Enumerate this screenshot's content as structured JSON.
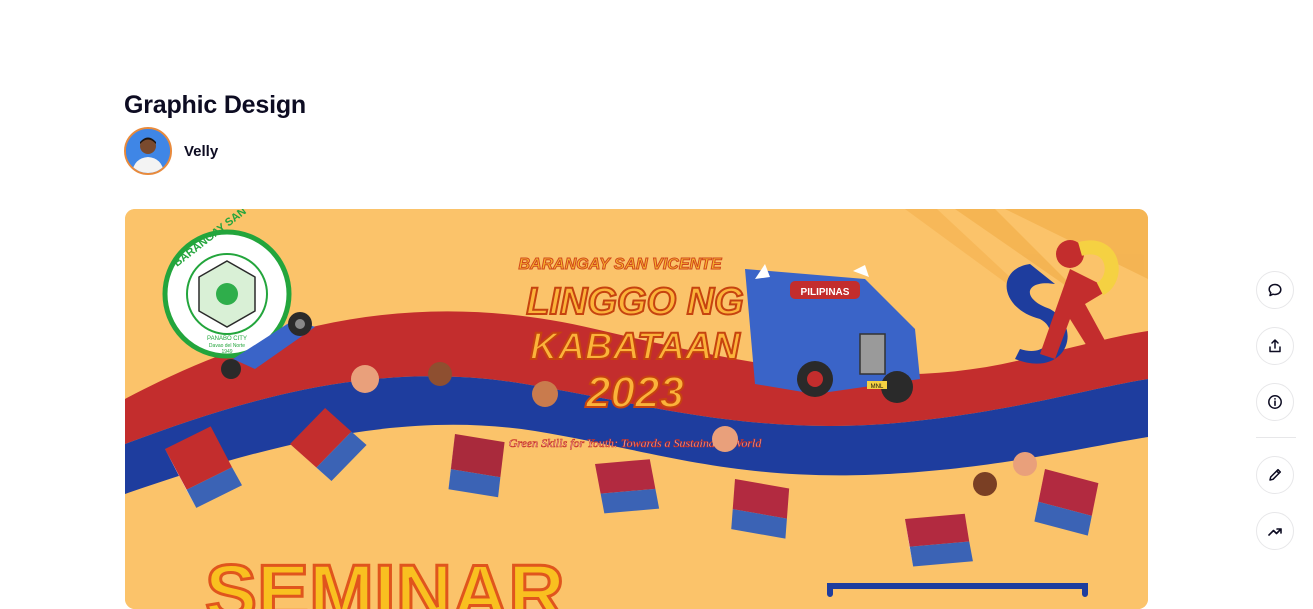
{
  "shot": {
    "title": "Graphic Design",
    "author": {
      "name": "Velly",
      "avatar_icon": "person-avatar"
    }
  },
  "artwork": {
    "seal_top_text": "BARANGAY SAN VICENTE",
    "seal_city": "PANABO CITY",
    "seal_province": "Davao del Norte",
    "seal_year": "1949",
    "headline_small": "BARANGAY SAN VICENTE",
    "headline_line1": "LINGGO NG",
    "headline_line2": "KABATAAN",
    "headline_year": "2023",
    "tagline": "Green Skills for Youth: Towards a Sustainable World",
    "jeep_sign": "PILIPINAS",
    "jeep_plate": "MNL",
    "bottom_word": "SEMINAR"
  },
  "actions": [
    {
      "name": "comments-button",
      "icon": "chat-bubble-icon"
    },
    {
      "name": "share-button",
      "icon": "share-icon"
    },
    {
      "name": "details-button",
      "icon": "info-icon"
    },
    {
      "name": "edit-button",
      "icon": "pencil-icon"
    },
    {
      "name": "insights-button",
      "icon": "trending-up-icon"
    }
  ],
  "colors": {
    "background": "#fbc36a",
    "ribbon_red": "#c32d2d",
    "ribbon_blue": "#1e3d9e",
    "headline_orange": "#f07a17",
    "seal_green": "#23a53c"
  }
}
